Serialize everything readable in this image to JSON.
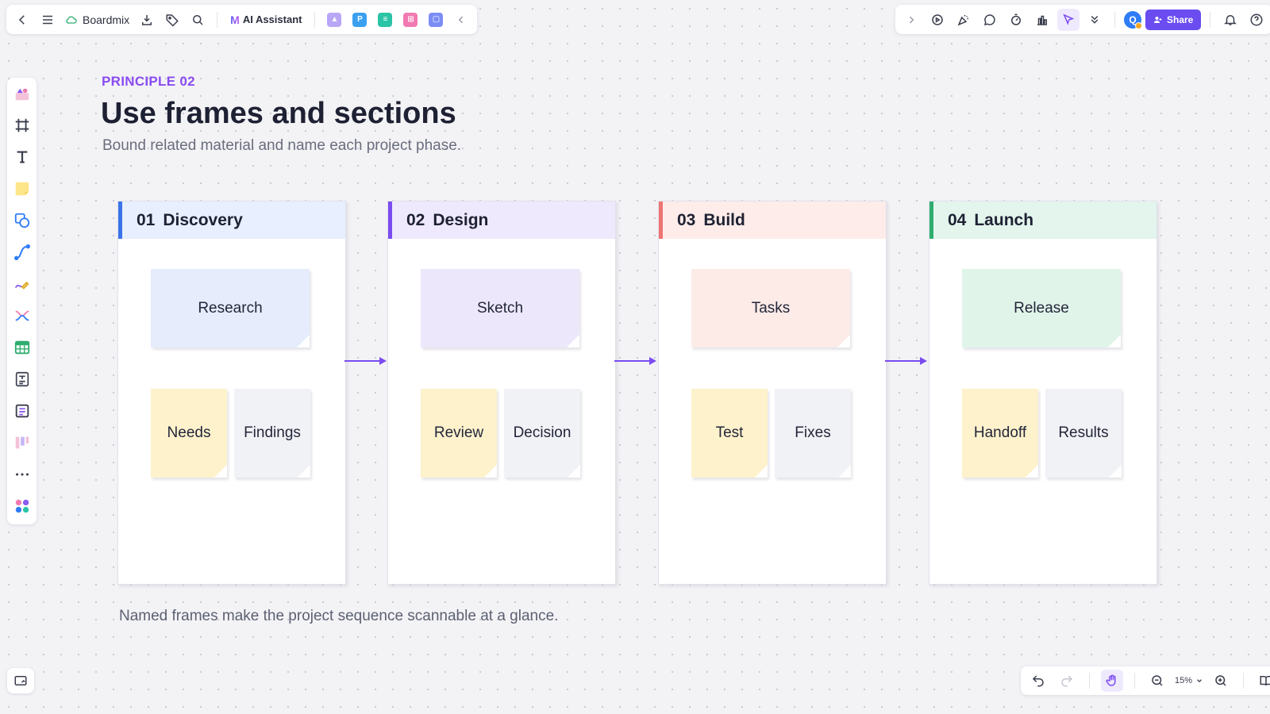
{
  "app": {
    "name": "Boardmix",
    "ai_label": "AI Assistant",
    "share_label": "Share",
    "avatar_initial": "Q"
  },
  "board": {
    "eyebrow": "PRINCIPLE 02",
    "title": "Use frames and sections",
    "subtitle": "Bound related material and name each project phase.",
    "footnote": "Named frames make the project sequence scannable at a glance.",
    "frames": [
      {
        "num": "01",
        "name": "Discovery",
        "accent": "#3b73e8",
        "head_bg": "#e8efff",
        "main_note": "Research",
        "main_color": "#e6ecfc",
        "notes": [
          "Needs",
          "Findings"
        ]
      },
      {
        "num": "02",
        "name": "Design",
        "accent": "#7b4cf0",
        "head_bg": "#efe9fd",
        "main_note": "Sketch",
        "main_color": "#ede7fc",
        "notes": [
          "Review",
          "Decision"
        ]
      },
      {
        "num": "03",
        "name": "Build",
        "accent": "#ee7474",
        "head_bg": "#fdece9",
        "main_note": "Tasks",
        "main_color": "#fdebe7",
        "notes": [
          "Test",
          "Fixes"
        ]
      },
      {
        "num": "04",
        "name": "Launch",
        "accent": "#2fad6e",
        "head_bg": "#e3f5ec",
        "main_note": "Release",
        "main_color": "#e1f4ea",
        "notes": [
          "Handoff",
          "Results"
        ]
      }
    ],
    "arrow_color": "#7b4cf0"
  },
  "zoom": {
    "level": "15%"
  }
}
